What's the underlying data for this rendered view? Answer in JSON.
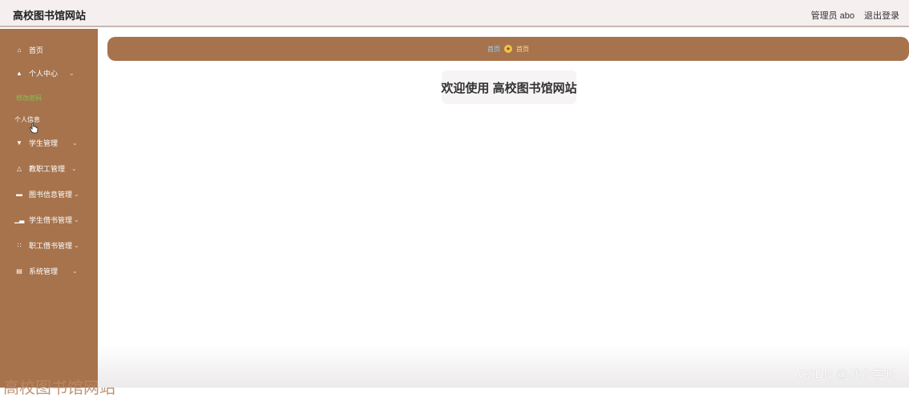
{
  "header": {
    "site_title": "高校图书馆网站",
    "user_label": "管理员 abo",
    "logout_label": "退出登录"
  },
  "sidebar": {
    "items": [
      {
        "label": "首页",
        "icon": "home-icon",
        "has_submenu": false
      },
      {
        "label": "个人中心",
        "icon": "user-icon",
        "has_submenu": true,
        "expanded": true
      },
      {
        "label": "学生管理",
        "icon": "student-icon",
        "has_submenu": true
      },
      {
        "label": "教职工管理",
        "icon": "staff-icon",
        "has_submenu": true
      },
      {
        "label": "图书信息管理",
        "icon": "book-icon",
        "has_submenu": true
      },
      {
        "label": "学生借书管理",
        "icon": "bar-chart-icon",
        "has_submenu": true
      },
      {
        "label": "职工借书管理",
        "icon": "grid-icon",
        "has_submenu": true
      },
      {
        "label": "系统管理",
        "icon": "system-icon",
        "has_submenu": true
      }
    ],
    "subitems": [
      {
        "label": "修改密码",
        "active": true
      },
      {
        "label": "个人信息",
        "active": false
      }
    ],
    "footer_text": "高校图书馆网站"
  },
  "breadcrumb": {
    "home": "首页",
    "current": "首页"
  },
  "main": {
    "welcome": "欢迎使用 高校图书馆网站"
  },
  "watermark": "CSDN @战少学长",
  "colors": {
    "sidebar_bg": "#a6734d",
    "topbar_bg": "#f5eff0",
    "active_sub": "#7ec84a",
    "breadcrumb_link": "#8fd6ff"
  }
}
